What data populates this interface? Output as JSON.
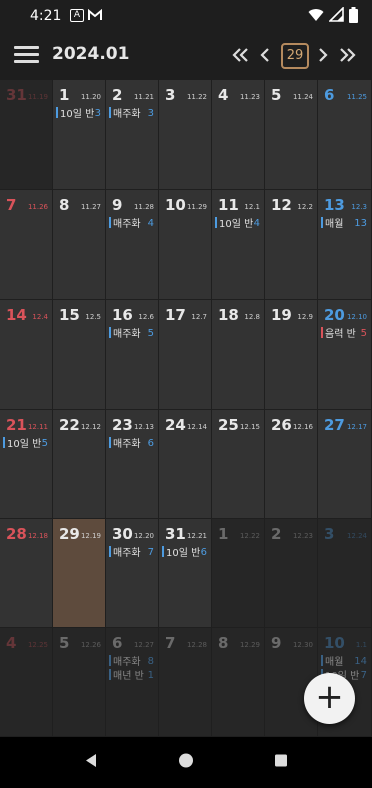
{
  "status": {
    "time": "4:21",
    "icons": [
      "notification-a-icon",
      "gmail-icon",
      "wifi-icon",
      "signal-icon",
      "battery-icon"
    ]
  },
  "header": {
    "title": "2024.01",
    "today": "29",
    "icons": [
      "menu-icon",
      "double-chevron-left-icon",
      "chevron-left-icon",
      "chevron-right-icon",
      "double-chevron-right-icon"
    ]
  },
  "colors": {
    "sunday": "#d9535a",
    "saturday": "#4d9be0",
    "weekday": "#e8e8e8",
    "event_bar": "#4d9be0",
    "event_bar_red": "#d9535a",
    "cell_bg": "#333333",
    "cell_dim_bg": "#262626",
    "cell_today_bg": "#5e4b3d"
  },
  "weeks": [
    [
      {
        "day": "31",
        "lunar": "11.19",
        "dim": true,
        "events": []
      },
      {
        "day": "1",
        "lunar": "11.20",
        "events": [
          {
            "text": "10일 반",
            "count": "3",
            "color": "blue"
          }
        ]
      },
      {
        "day": "2",
        "lunar": "11.21",
        "events": [
          {
            "text": "매주화",
            "count": "3",
            "color": "blue"
          }
        ]
      },
      {
        "day": "3",
        "lunar": "11.22",
        "events": []
      },
      {
        "day": "4",
        "lunar": "11.23",
        "events": []
      },
      {
        "day": "5",
        "lunar": "11.24",
        "events": []
      },
      {
        "day": "6",
        "lunar": "11.25",
        "events": []
      }
    ],
    [
      {
        "day": "7",
        "lunar": "11.26",
        "events": []
      },
      {
        "day": "8",
        "lunar": "11.27",
        "events": []
      },
      {
        "day": "9",
        "lunar": "11.28",
        "events": [
          {
            "text": "매주화",
            "count": "4",
            "color": "blue"
          }
        ]
      },
      {
        "day": "10",
        "lunar": "11.29",
        "events": []
      },
      {
        "day": "11",
        "lunar": "12.1",
        "events": [
          {
            "text": "10일 반",
            "count": "4",
            "color": "blue"
          }
        ]
      },
      {
        "day": "12",
        "lunar": "12.2",
        "events": []
      },
      {
        "day": "13",
        "lunar": "12.3",
        "events": [
          {
            "text": "매월",
            "count": "13",
            "color": "blue"
          }
        ]
      }
    ],
    [
      {
        "day": "14",
        "lunar": "12.4",
        "events": []
      },
      {
        "day": "15",
        "lunar": "12.5",
        "events": []
      },
      {
        "day": "16",
        "lunar": "12.6",
        "events": [
          {
            "text": "매주화",
            "count": "5",
            "color": "blue"
          }
        ]
      },
      {
        "day": "17",
        "lunar": "12.7",
        "events": []
      },
      {
        "day": "18",
        "lunar": "12.8",
        "events": []
      },
      {
        "day": "19",
        "lunar": "12.9",
        "events": []
      },
      {
        "day": "20",
        "lunar": "12.10",
        "events": [
          {
            "text": "음력 반",
            "count": "5",
            "color": "red"
          }
        ]
      }
    ],
    [
      {
        "day": "21",
        "lunar": "12.11",
        "events": [
          {
            "text": "10일 반",
            "count": "5",
            "color": "blue"
          }
        ]
      },
      {
        "day": "22",
        "lunar": "12.12",
        "events": []
      },
      {
        "day": "23",
        "lunar": "12.13",
        "events": [
          {
            "text": "매주화",
            "count": "6",
            "color": "blue"
          }
        ]
      },
      {
        "day": "24",
        "lunar": "12.14",
        "events": []
      },
      {
        "day": "25",
        "lunar": "12.15",
        "events": []
      },
      {
        "day": "26",
        "lunar": "12.16",
        "events": []
      },
      {
        "day": "27",
        "lunar": "12.17",
        "events": []
      }
    ],
    [
      {
        "day": "28",
        "lunar": "12.18",
        "events": []
      },
      {
        "day": "29",
        "lunar": "12.19",
        "today": true,
        "events": []
      },
      {
        "day": "30",
        "lunar": "12.20",
        "events": [
          {
            "text": "매주화",
            "count": "7",
            "color": "blue"
          }
        ]
      },
      {
        "day": "31",
        "lunar": "12.21",
        "events": [
          {
            "text": "10일 반",
            "count": "6",
            "color": "blue"
          }
        ]
      },
      {
        "day": "1",
        "lunar": "12.22",
        "dim": true,
        "events": []
      },
      {
        "day": "2",
        "lunar": "12.23",
        "dim": true,
        "events": []
      },
      {
        "day": "3",
        "lunar": "12.24",
        "dim": true,
        "events": []
      }
    ],
    [
      {
        "day": "4",
        "lunar": "12.25",
        "dim": true,
        "events": []
      },
      {
        "day": "5",
        "lunar": "12.26",
        "dim": true,
        "events": []
      },
      {
        "day": "6",
        "lunar": "12.27",
        "dim": true,
        "events": [
          {
            "text": "매주화",
            "count": "8",
            "color": "blue"
          },
          {
            "text": "매년 반",
            "count": "1",
            "color": "blue"
          }
        ]
      },
      {
        "day": "7",
        "lunar": "12.28",
        "dim": true,
        "events": []
      },
      {
        "day": "8",
        "lunar": "12.29",
        "dim": true,
        "events": []
      },
      {
        "day": "9",
        "lunar": "12.30",
        "dim": true,
        "events": []
      },
      {
        "day": "10",
        "lunar": "1.1",
        "dim": true,
        "events": [
          {
            "text": "매월",
            "count": "14",
            "color": "blue"
          },
          {
            "text": "10일 반",
            "count": "7",
            "color": "blue"
          }
        ]
      }
    ]
  ],
  "fab": {
    "label": "+",
    "icon": "plus-icon"
  },
  "navbar": {
    "icons": [
      "back-icon",
      "home-icon",
      "recents-icon"
    ]
  }
}
